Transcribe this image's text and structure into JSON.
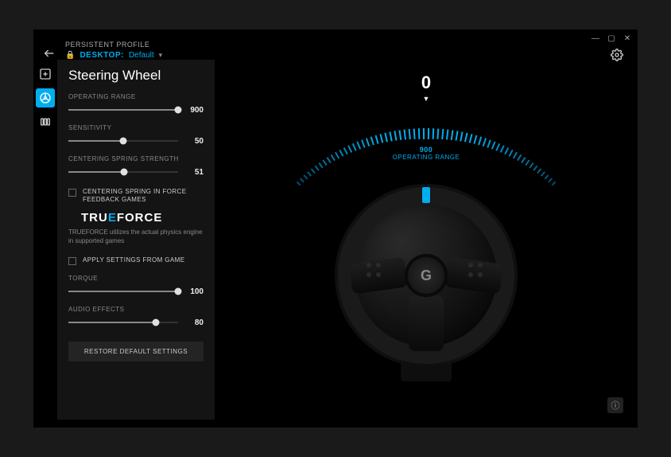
{
  "window": {
    "minimize": "—",
    "maximize": "▢",
    "close": "✕"
  },
  "header": {
    "profile_label": "PERSISTENT PROFILE",
    "desktop_label": "DESKTOP:",
    "desktop_value": "Default"
  },
  "panel": {
    "title": "Steering Wheel",
    "operating_range": {
      "label": "OPERATING RANGE",
      "value": "900",
      "pct": 100
    },
    "sensitivity": {
      "label": "SENSITIVITY",
      "value": "50",
      "pct": 50
    },
    "centering_spring": {
      "label": "CENTERING SPRING STRENGTH",
      "value": "51",
      "pct": 51
    },
    "spring_games_checkbox": "CENTERING SPRING IN FORCE FEEDBACK GAMES",
    "trueforce_brand": "TRUEFORCE",
    "trueforce_desc": "TRUEFORCE utilizes the actual physics engine in supported games",
    "apply_settings": "APPLY SETTINGS FROM GAME",
    "torque": {
      "label": "TORQUE",
      "value": "100",
      "pct": 100
    },
    "audio_fx": {
      "label": "AUDIO EFFECTS",
      "value": "80",
      "pct": 80
    },
    "restore_btn": "RESTORE DEFAULT SETTINGS"
  },
  "viz": {
    "angle": "0",
    "range_num": "900",
    "range_label": "OPERATING RANGE",
    "logo": "G"
  },
  "colors": {
    "accent": "#00aeef"
  }
}
